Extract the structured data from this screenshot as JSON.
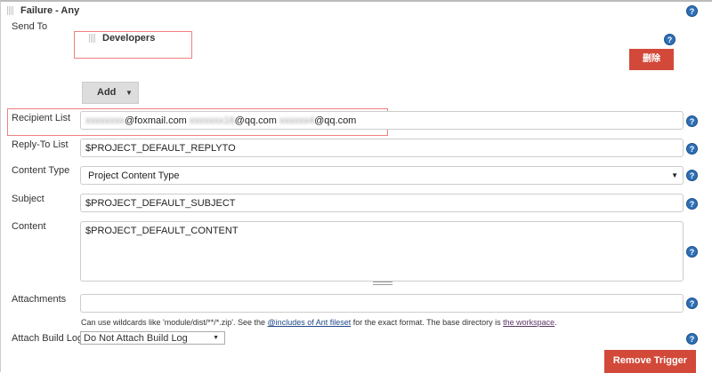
{
  "section_title": "Failure - Any",
  "send_to": {
    "label": "Send To",
    "recipient_provider": "Developers",
    "delete_label": "删除",
    "add_label": "Add"
  },
  "recipient_list": {
    "label": "Recipient List",
    "value_parts": [
      "xxxxxxxx",
      "@foxmail.com",
      "xxxxxxx16",
      "@qq.com",
      "xxxxxx4",
      "@qq.com"
    ]
  },
  "reply_to": {
    "label": "Reply-To List",
    "value": "$PROJECT_DEFAULT_REPLYTO"
  },
  "content_type": {
    "label": "Content Type",
    "value": "Project Content Type"
  },
  "subject": {
    "label": "Subject",
    "value": "$PROJECT_DEFAULT_SUBJECT"
  },
  "content": {
    "label": "Content",
    "value": "$PROJECT_DEFAULT_CONTENT"
  },
  "attachments": {
    "label": "Attachments",
    "value": "",
    "hint_pre": "Can use wildcards like 'module/dist/**/*.zip'. See the ",
    "hint_link1": "@includes of Ant fileset",
    "hint_mid": " for the exact format. The base directory is ",
    "hint_link2": "the workspace",
    "hint_post": "."
  },
  "attach_build_log": {
    "label": "Attach Build Log",
    "value": "Do Not Attach Build Log"
  },
  "remove_trigger_label": "Remove Trigger",
  "help_glyph": "?"
}
